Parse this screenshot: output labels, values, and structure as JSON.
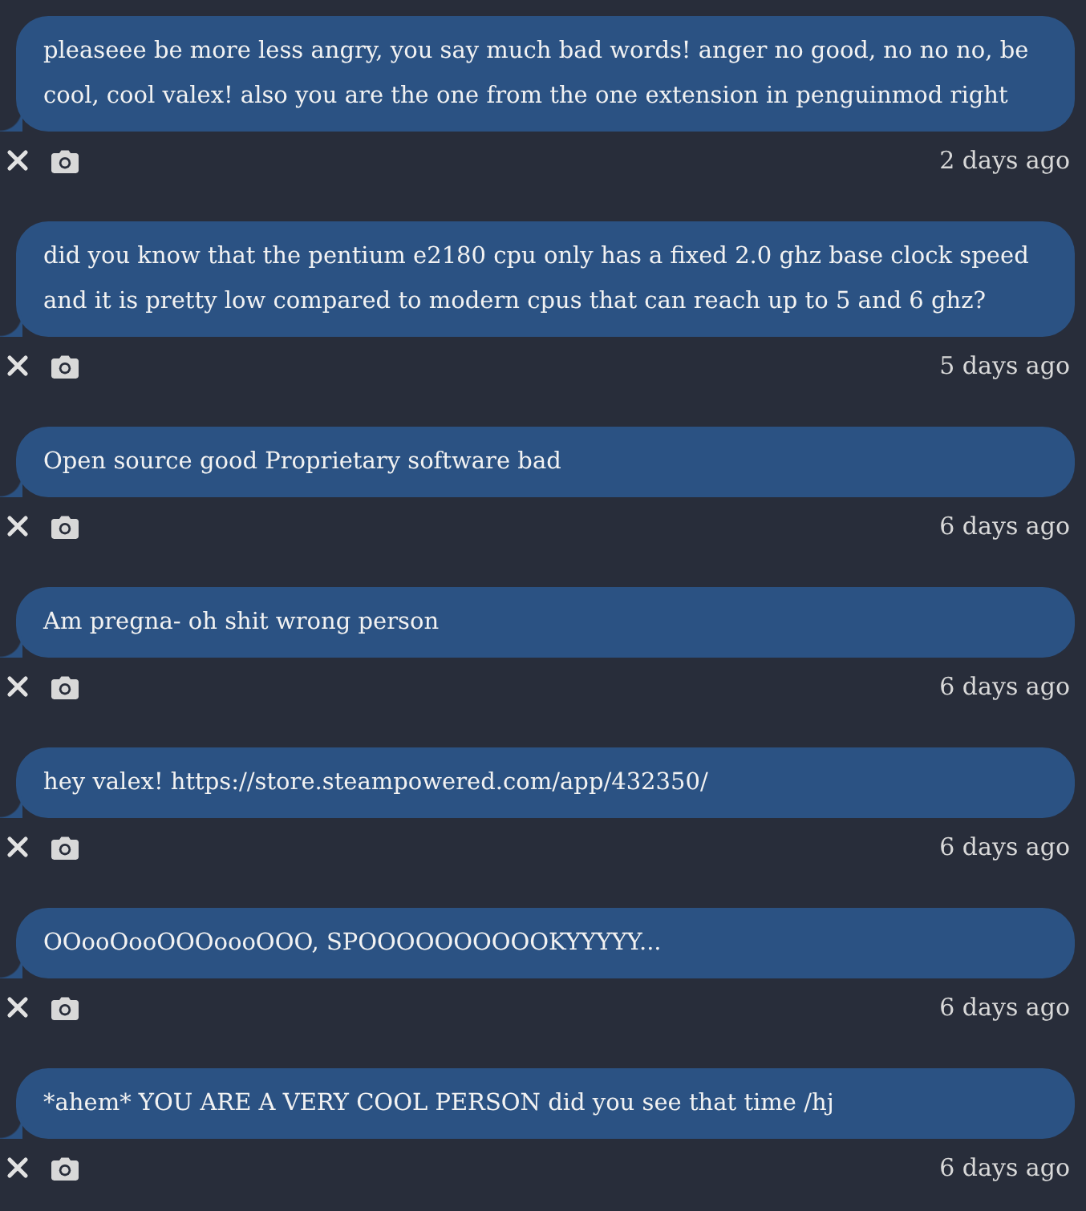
{
  "messages": [
    {
      "text": "pleaseee be more less angry, you say much bad words! anger no good, no no no, be cool, cool valex! also you are the one from the one extension in penguinmod right",
      "time": "2 days ago"
    },
    {
      "text": "did you know that the pentium e2180 cpu only has a fixed 2.0 ghz base clock speed and it is pretty low compared to modern cpus that can reach up to 5 and 6 ghz?",
      "time": "5 days ago"
    },
    {
      "text": "Open source good Proprietary software bad",
      "time": "6 days ago"
    },
    {
      "text": "Am pregna- oh shit wrong person",
      "time": "6 days ago"
    },
    {
      "text": "hey valex! https://store.steampowered.com/app/432350/",
      "time": "6 days ago"
    },
    {
      "text": "OOooOooOOOoooOOO, SPOOOOOOOOOOKYYYYY...",
      "time": "6 days ago"
    },
    {
      "text": "*ahem* YOU ARE A VERY COOL PERSON did you see that time /hj",
      "time": "6 days ago"
    }
  ]
}
